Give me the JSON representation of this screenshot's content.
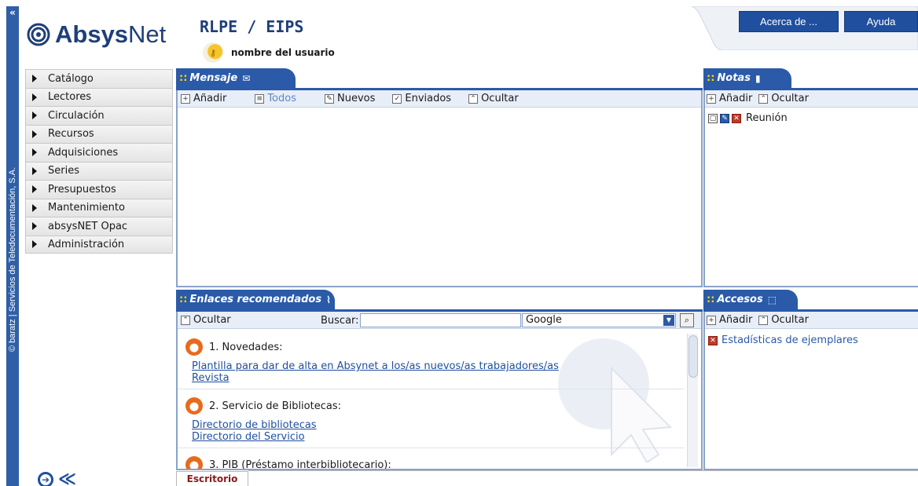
{
  "app": {
    "logo_bold": "Absys",
    "logo_thin": "Net",
    "title": "RLPE / EIPS",
    "user_name": "nombre del usuario",
    "vertical_text": "© baratz | Servicios de Teledocumentación, S.A."
  },
  "header": {
    "about_label": "Acerca de ...",
    "help_label": "Ayuda"
  },
  "sidebar": {
    "items": [
      {
        "label": "Catálogo"
      },
      {
        "label": "Lectores"
      },
      {
        "label": "Circulación"
      },
      {
        "label": "Recursos"
      },
      {
        "label": "Adquisiciones"
      },
      {
        "label": "Series"
      },
      {
        "label": "Presupuestos"
      },
      {
        "label": "Mantenimiento"
      },
      {
        "label": "absysNET Opac"
      },
      {
        "label": "Administración"
      }
    ]
  },
  "mensaje": {
    "tab_label": "Mensaje",
    "actions": {
      "add": "Añadir",
      "all": "Todos",
      "new": "Nuevos",
      "sent": "Enviados",
      "hide": "Ocultar"
    }
  },
  "notas": {
    "tab_label": "Notas",
    "actions": {
      "add": "Añadir",
      "hide": "Ocultar"
    },
    "items": [
      {
        "label": "Reunión"
      }
    ]
  },
  "enlaces": {
    "tab_label": "Enlaces recomendados",
    "hide_label": "Ocultar",
    "search_label": "Buscar:",
    "search_value": "",
    "engine_selected": "Google",
    "sections": [
      {
        "title": "1. Novedades:",
        "links": [
          "Plantilla para dar de alta en Absynet a los/as nuevos/as trabajadores/as",
          "Revista"
        ]
      },
      {
        "title": "2. Servicio de Bibliotecas:",
        "links": [
          "Directorio de bibliotecas",
          "Directorio del Servicio"
        ]
      },
      {
        "title": "3. PIB (Préstamo interbibliotecario):",
        "links": []
      }
    ]
  },
  "accesos": {
    "tab_label": "Accesos",
    "actions": {
      "add": "Añadir",
      "hide": "Ocultar"
    },
    "items": [
      {
        "label": "Estadísticas de ejemplares"
      }
    ]
  },
  "footer": {
    "desk_tab": "Escritorio"
  },
  "colors": {
    "brand_blue": "#2a5aa8",
    "link_blue": "#1f4f9e",
    "tab_text_red": "#8b1a1a"
  }
}
